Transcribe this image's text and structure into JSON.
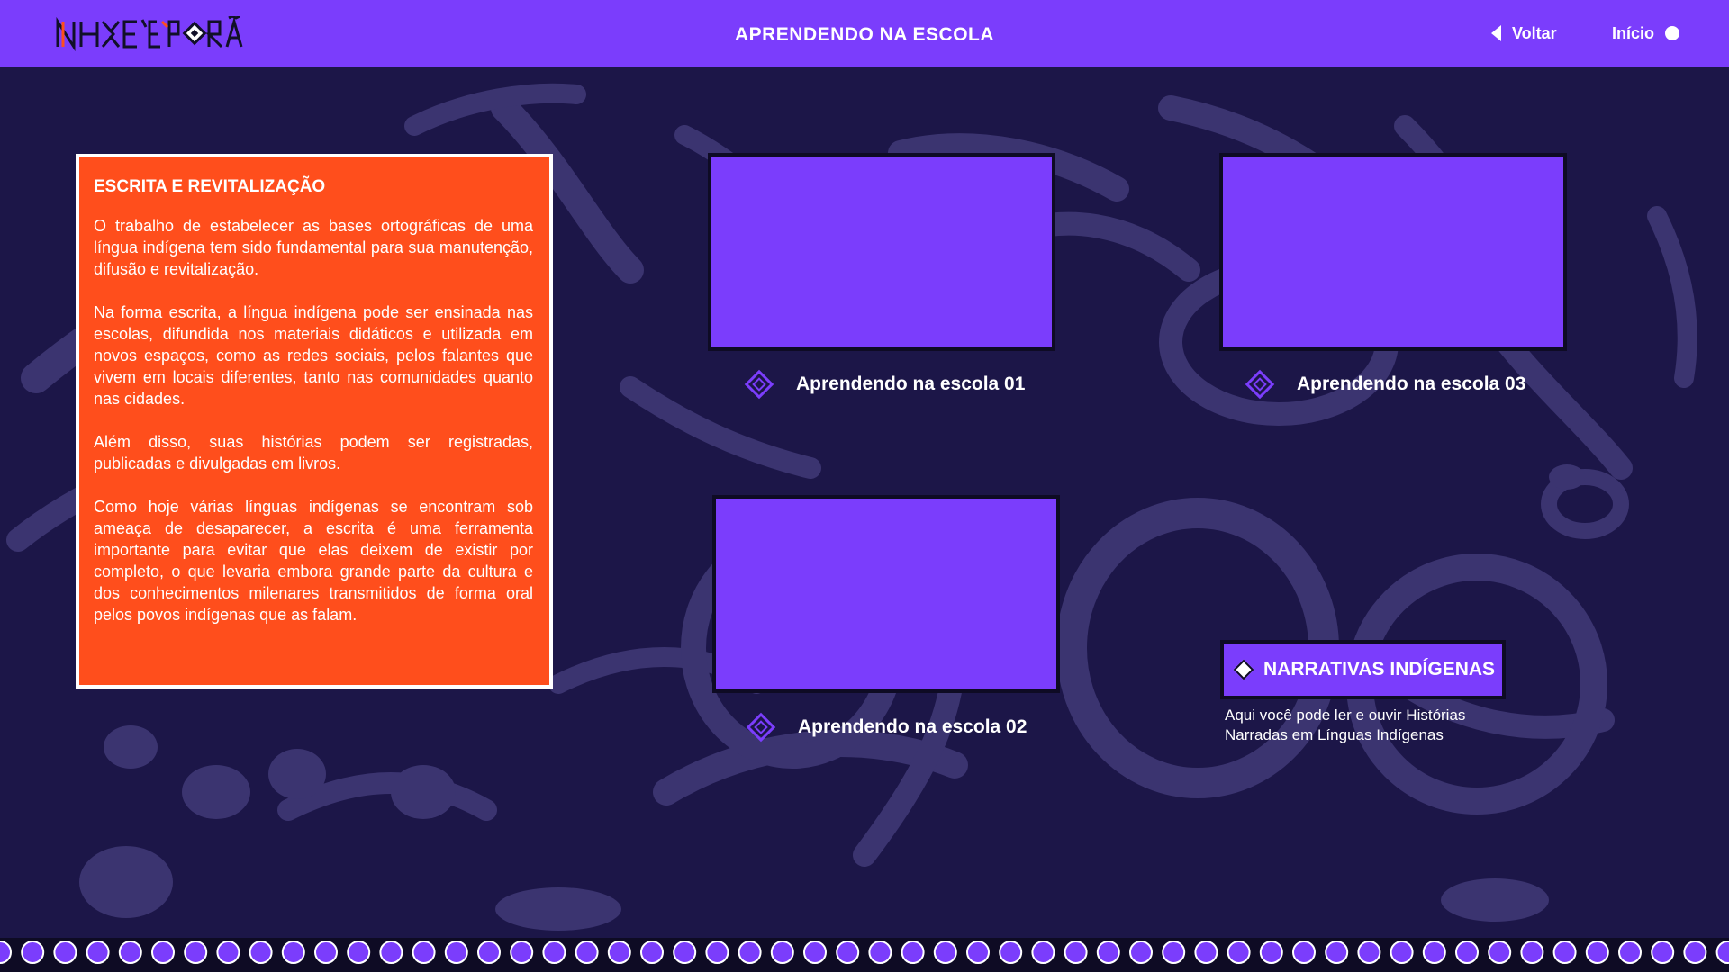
{
  "app": {
    "logo_text": "NHE'Ẽ PORÃ",
    "page_title": "APRENDENDO NA ESCOLA"
  },
  "nav": {
    "back_label": "Voltar",
    "home_label": "Início"
  },
  "info": {
    "title": "ESCRITA E REVITALIZAÇÃO",
    "paragraphs": [
      "O trabalho de estabelecer as bases ortográficas de uma língua indígena tem sido fundamental para sua manutenção, difusão e revitalização.",
      "Na forma escrita, a língua indígena pode ser ensinada nas escolas, difundida nos materiais didáticos e utilizada em novos espaços, como as redes sociais, pelos falantes que vivem em locais diferentes, tanto nas comunidades quanto nas cidades.",
      "Além disso, suas histórias podem ser registradas, publicadas e divulgadas em livros.",
      "Como hoje várias línguas indígenas se encontram sob ameaça de desaparecer, a escrita é uma ferramenta importante para evitar que elas deixem de existir por completo, o que levaria embora grande parte da cultura e dos conhecimentos milenares transmitidos de forma oral pelos povos indígenas que as falam."
    ]
  },
  "videos": [
    {
      "label": "Aprendendo na escola 01"
    },
    {
      "label": "Aprendendo na escola 02"
    },
    {
      "label": "Aprendendo na escola 03"
    }
  ],
  "narrativas": {
    "button_label": "NARRATIVAS INDÍGENAS",
    "description": "Aqui você pode ler e ouvir Histórias Narradas em Línguas Indígenas"
  },
  "colors": {
    "header": "#7b3dfc",
    "background": "#1c1648",
    "panel": "#ff4e1c",
    "card": "#7b3dfc",
    "brush": "#3b3470"
  },
  "icons": {
    "back": "triangle-left-icon",
    "home": "dot-icon",
    "item": "diamond-icon"
  }
}
